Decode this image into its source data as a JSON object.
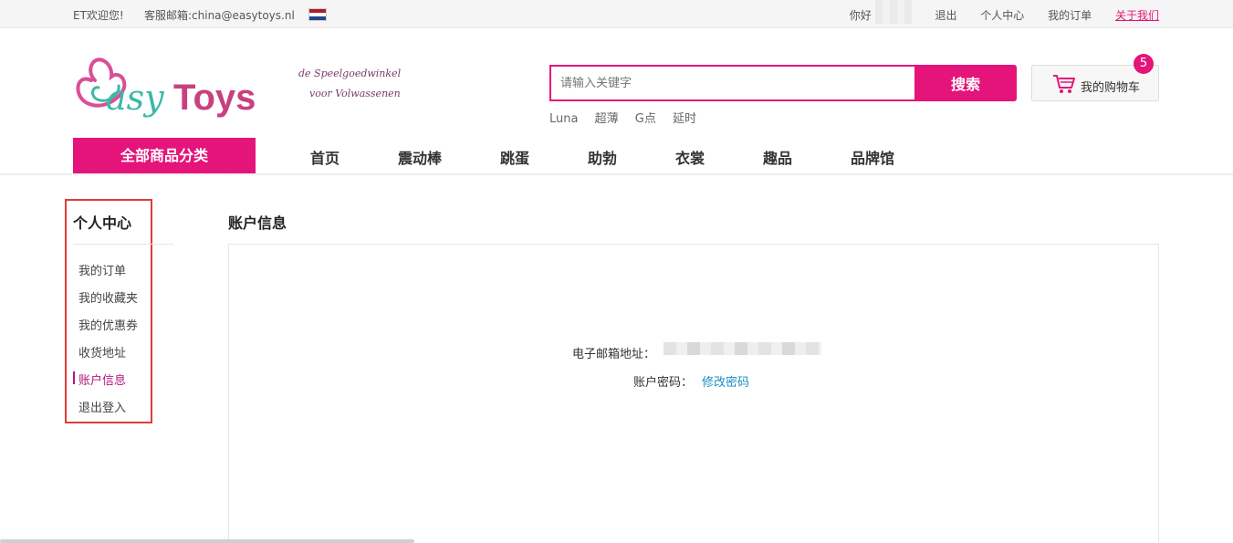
{
  "topbar": {
    "welcome": "ET欢迎您!",
    "service_email": "客服邮箱:china@easytoys.nl",
    "greeting": "你好",
    "links": [
      {
        "label": "退出"
      },
      {
        "label": "个人中心"
      },
      {
        "label": "我的订单"
      },
      {
        "label": "关于我们"
      }
    ]
  },
  "header": {
    "logo_text": "EasyToys",
    "slogan_line1": "de Speelgoedwinkel",
    "slogan_line2": "voor Volwassenen",
    "search": {
      "placeholder": "请输入关键字",
      "button_label": "搜索",
      "hot_words": [
        "Luna",
        "超薄",
        "G点",
        "延时"
      ]
    },
    "cart": {
      "label": "我的购物车",
      "count": "5"
    }
  },
  "nav": {
    "all_categories": "全部商品分类",
    "items": [
      "首页",
      "震动棒",
      "跳蛋",
      "助勃",
      "衣裳",
      "趣品",
      "品牌馆"
    ]
  },
  "sidebar": {
    "title": "个人中心",
    "items": [
      {
        "label": "我的订单"
      },
      {
        "label": "我的收藏夹"
      },
      {
        "label": "我的优惠券"
      },
      {
        "label": "收货地址"
      },
      {
        "label": "账户信息"
      },
      {
        "label": "退出登入"
      }
    ]
  },
  "main": {
    "title": "账户信息",
    "email_label": "电子邮箱地址：",
    "password_label": "账户密码：",
    "change_password": "修改密码"
  },
  "colors": {
    "brand_pink": "#e4147a",
    "active_purple": "#b5177f",
    "link_blue": "#1a8fc2",
    "highlight_red": "#e03b3b"
  }
}
